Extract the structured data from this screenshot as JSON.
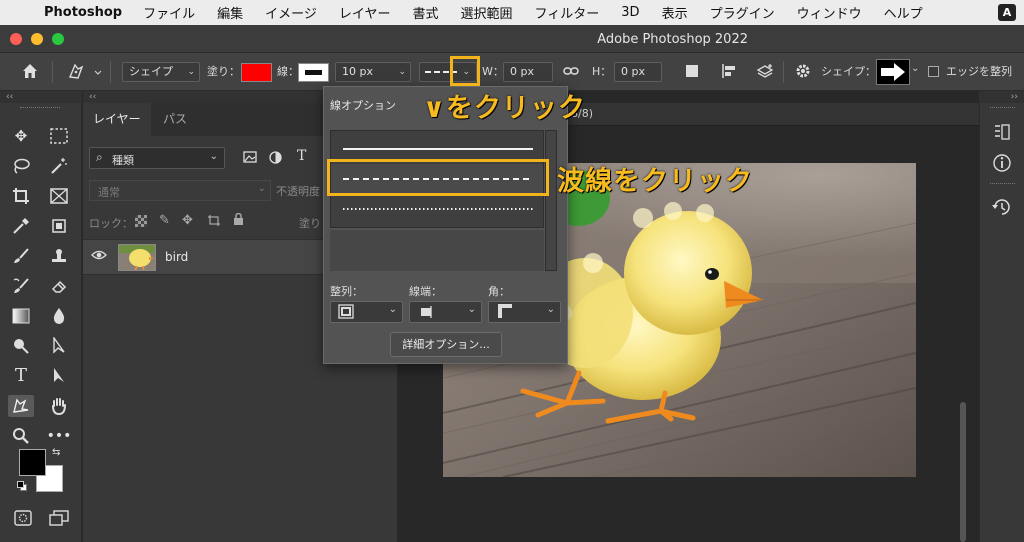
{
  "menubar": {
    "app_name": "Photoshop",
    "items": [
      "ファイル",
      "編集",
      "イメージ",
      "レイヤー",
      "書式",
      "選択範囲",
      "フィルター",
      "3D",
      "表示",
      "プラグイン",
      "ウィンドウ",
      "ヘルプ"
    ],
    "input_badge": "A"
  },
  "window": {
    "title": "Adobe Photoshop 2022"
  },
  "options_bar": {
    "mode_value": "シェイプ",
    "fill_label": "塗り：",
    "fill_color": "#ff0000",
    "stroke_label": "線：",
    "stroke_width": "10 px",
    "w_label": "W：",
    "w_value": "0 px",
    "h_label": "H：",
    "h_value": "0 px",
    "shape_label": "シェイプ：",
    "align_edges_label": "エッジを整列"
  },
  "layers_panel": {
    "tabs": [
      "レイヤー",
      "パス"
    ],
    "filter_value": "種類",
    "blend_mode": "通常",
    "opacity_label": "不透明度",
    "lock_label": "ロック：",
    "fill_label": "塗り",
    "layer_name": "bird"
  },
  "stroke_options": {
    "title": "線オプション",
    "styles": [
      "solid",
      "dashed",
      "dotted"
    ],
    "selected_style": "dashed",
    "align_label": "整列：",
    "caps_label": "線端：",
    "corners_label": "角：",
    "more_options_button": "詳細オプション..."
  },
  "doc_tab_fragment": "8/8)",
  "annotations": {
    "dropdown_note": "∨をクリック",
    "dashed_note": "波線をクリック",
    "highlight_color": "#f3b41b"
  },
  "colors": {
    "foreground": "#000000",
    "background": "#ffffff"
  }
}
